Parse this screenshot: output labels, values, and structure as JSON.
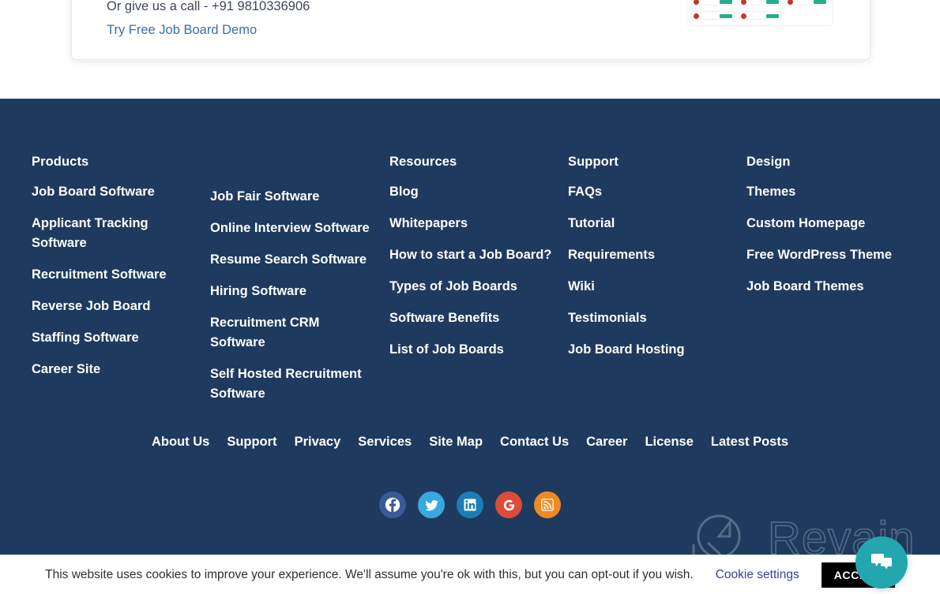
{
  "cta": {
    "call_line": "Or give us a call - +91 9810336906",
    "demo_link": "Try Free Job Board Demo"
  },
  "footer": {
    "background_color": "#1e3a5f",
    "columns": [
      {
        "heading": "Products",
        "links": [
          "Job Board Software",
          "Applicant Tracking Software",
          "Recruitment Software",
          "Reverse Job Board",
          "Staffing Software",
          "Career Site"
        ]
      },
      {
        "heading": "",
        "links": [
          "Job Fair Software",
          "Online Interview Software",
          "Resume Search Software",
          "Hiring Software",
          "Recruitment CRM Software",
          "Self Hosted Recruitment Software"
        ]
      },
      {
        "heading": "Resources",
        "links": [
          "Blog",
          "Whitepapers",
          "How to start a Job Board?",
          "Types of Job Boards",
          "Software Benefits",
          "List of Job Boards"
        ]
      },
      {
        "heading": "Support",
        "links": [
          "FAQs",
          "Tutorial",
          "Requirements",
          "Wiki",
          "Testimonials",
          "Job Board Hosting"
        ]
      },
      {
        "heading": "Design",
        "links": [
          "Themes",
          "Custom Homepage",
          "Free WordPress Theme",
          "Job Board Themes"
        ]
      }
    ],
    "bottom_nav": [
      "About Us",
      "Support",
      "Privacy",
      "Services",
      "Site Map",
      "Contact Us",
      "Career",
      "License",
      "Latest Posts"
    ],
    "social": [
      {
        "name": "facebook",
        "label": "Facebook",
        "color": "#3b5998"
      },
      {
        "name": "twitter",
        "label": "Twitter",
        "color": "#38a8e0"
      },
      {
        "name": "linkedin",
        "label": "LinkedIn",
        "color": "#1b7fb5"
      },
      {
        "name": "google",
        "label": "Google",
        "color": "#dd4b39"
      },
      {
        "name": "rss",
        "label": "RSS",
        "color": "#ef8a22"
      }
    ]
  },
  "cookie_bar": {
    "message": "This website uses cookies to improve your experience. We'll assume you're ok with this, but you can opt-out if you wish.",
    "settings_label": "Cookie settings",
    "accept_label": "ACCEPT"
  },
  "watermark": {
    "text": "Revain"
  }
}
